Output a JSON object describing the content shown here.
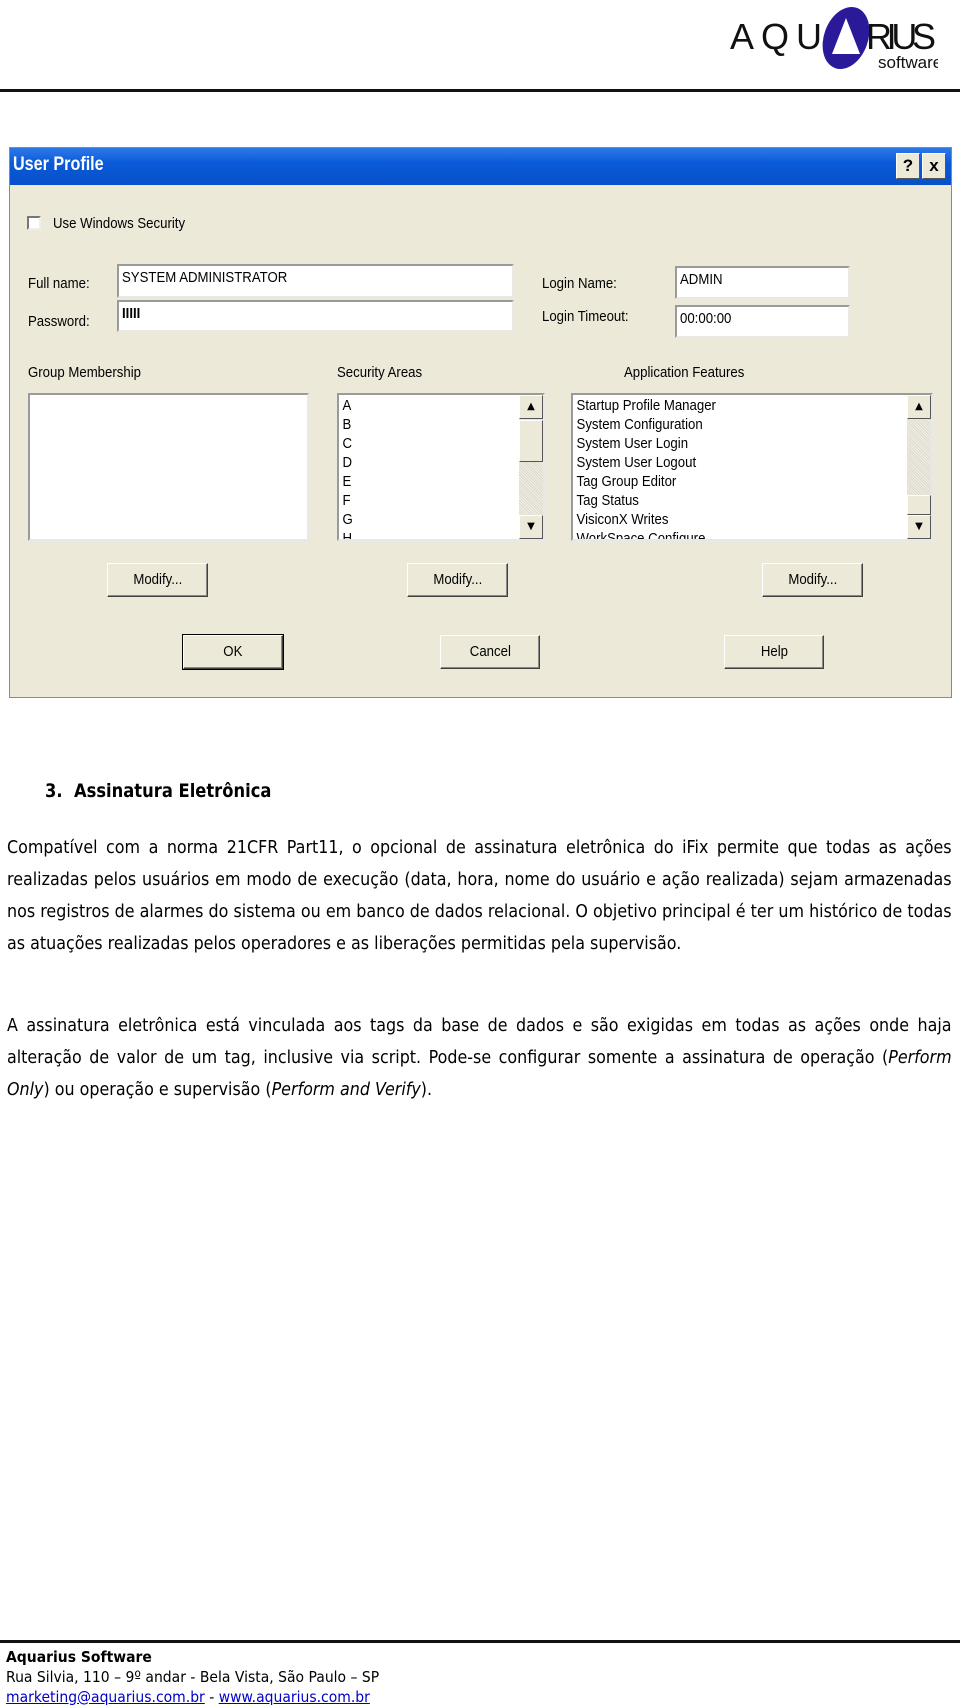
{
  "logo": {
    "text": "AQUARIUS",
    "sub": "software",
    "color": "#2a1a9a"
  },
  "dialog": {
    "title": "User Profile",
    "help_btn": "?",
    "close_btn": "x",
    "use_windows_security": {
      "label": "Use Windows Security",
      "checked": false
    },
    "full_name": {
      "label": "Full name:",
      "value": "SYSTEM ADMINISTRATOR"
    },
    "password": {
      "label": "Password:",
      "value": "IIIII"
    },
    "login_name": {
      "label": "Login Name:",
      "value": "ADMIN"
    },
    "login_timeout": {
      "label": "Login Timeout:",
      "value": "00:00:00"
    },
    "group_membership": {
      "label": "Group Membership",
      "items": []
    },
    "security_areas": {
      "label": "Security Areas",
      "items": [
        "A",
        "B",
        "C",
        "D",
        "E",
        "F",
        "G",
        "H"
      ]
    },
    "application_features": {
      "label": "Application Features",
      "items": [
        "Startup Profile Manager",
        "System Configuration",
        "System User Login",
        "System User Logout",
        "Tag Group Editor",
        "Tag Status",
        "VisiconX Writes",
        "WorkSpace Configure"
      ]
    },
    "modify": "Modify...",
    "ok": "OK",
    "cancel": "Cancel",
    "help": "Help",
    "titlebar_color": "#0a5ad8"
  },
  "section": {
    "heading": "3.  Assinatura Eletrônica",
    "p1": "Compatível com a norma 21CFR Part11, o opcional de assinatura eletrônica do iFix permite que todas as ações realizadas pelos usuários em modo de execução (data, hora, nome do usuário e ação realizada) sejam armazenadas nos registros de alarmes do sistema ou em banco de dados relacional. O objetivo principal é ter um histórico de todas as atuações realizadas pelos operadores e as liberações permitidas pela supervisão.",
    "p2_a": "A assinatura eletrônica está vinculada aos tags da base de dados e são exigidas em todas as ações onde haja alteração de valor de um tag, inclusive via script. Pode-se configurar somente a assinatura de operação (",
    "p2_i1": "Perform Only",
    "p2_b": ") ou operação e supervisão (",
    "p2_i2": "Perform and Verify",
    "p2_c": ")."
  },
  "footer": {
    "company": "Aquarius Software",
    "address": "Rua Silvia, 110 – 9º andar - Bela Vista, São Paulo – SP",
    "email": "marketing@aquarius.com.br",
    "sep": " - ",
    "web": "www.aquarius.com.br"
  }
}
